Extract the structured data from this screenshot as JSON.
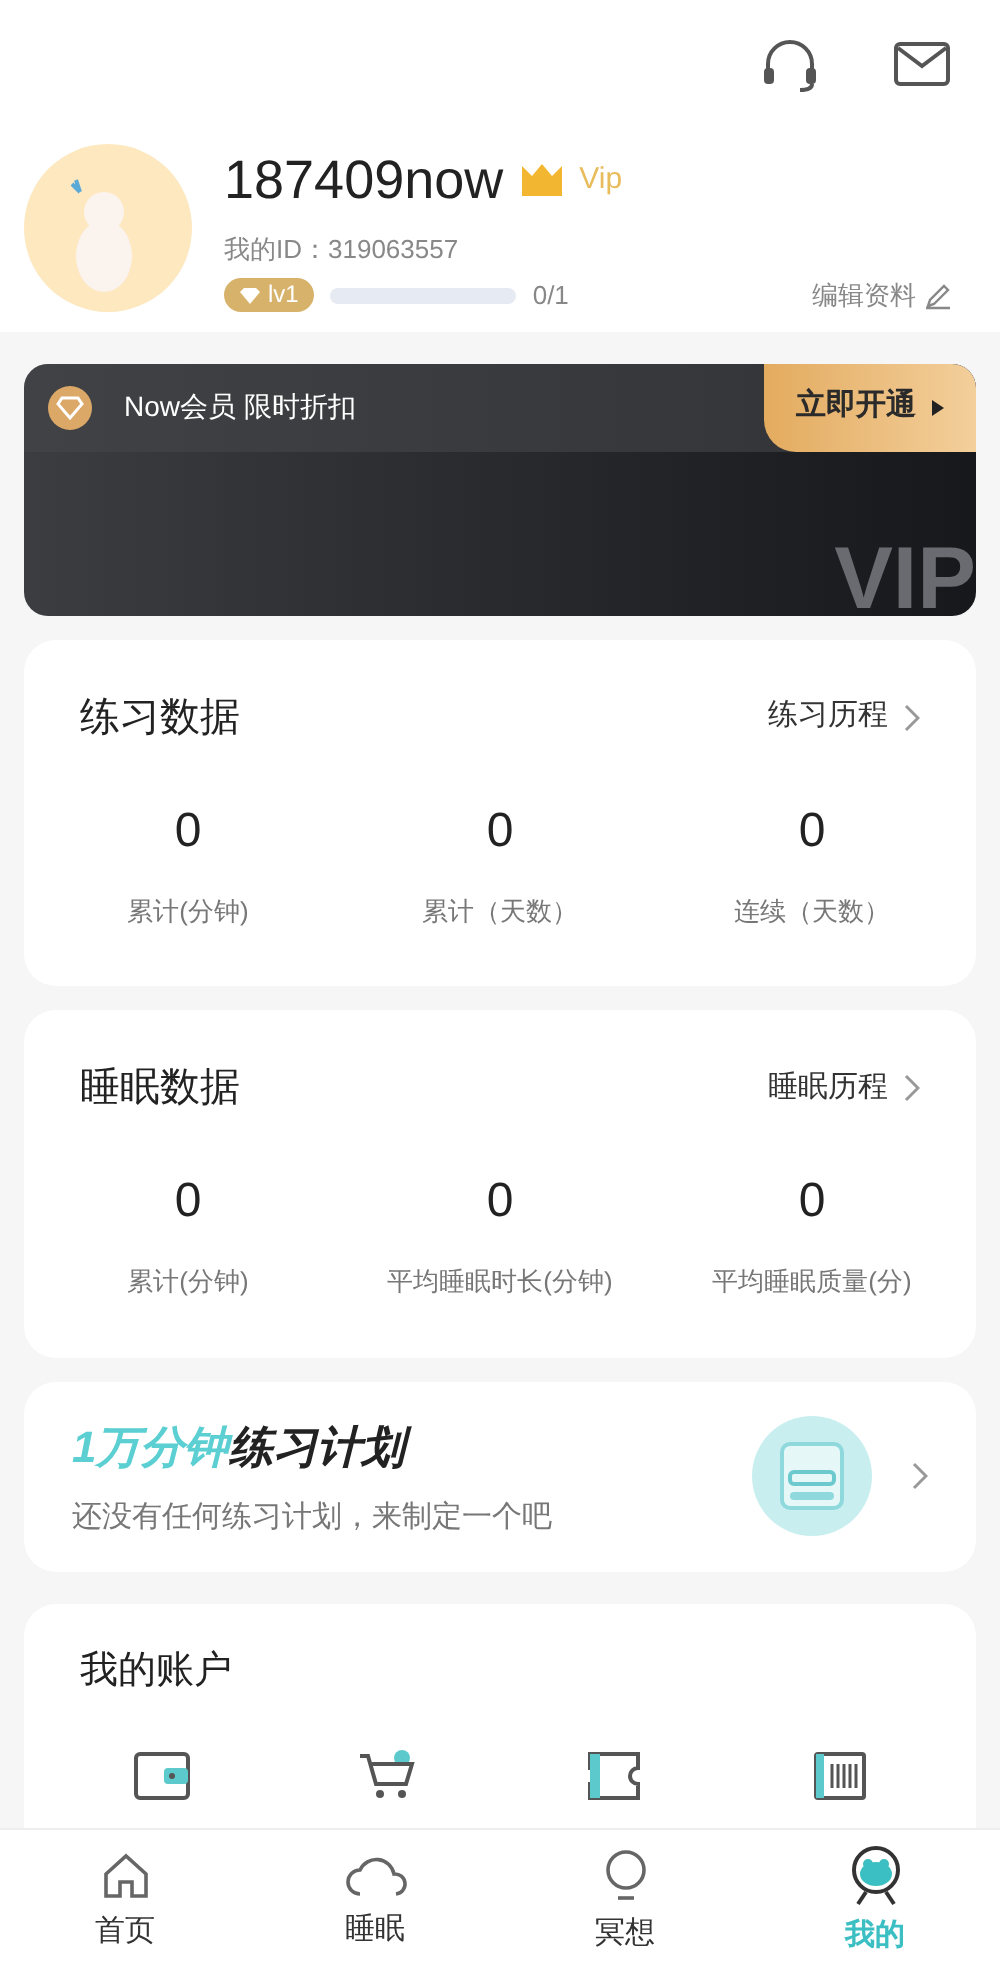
{
  "profile": {
    "username": "187409now",
    "vip_label": "Vip",
    "id_text": "我的ID：319063557",
    "level_badge": "lv1",
    "level": 0,
    "progress_text": "0/1",
    "edit_link": "编辑资料"
  },
  "vip_banner": {
    "title": "Now会员 限时折扣",
    "button": "立即开通",
    "watermark": "VIP"
  },
  "practice": {
    "title": "练习数据",
    "link": "练习历程",
    "stats": [
      {
        "value": "0",
        "label": "累计(分钟)"
      },
      {
        "value": "0",
        "label": "累计（天数）"
      },
      {
        "value": "0",
        "label": "连续（天数）"
      }
    ]
  },
  "sleep": {
    "title": "睡眠数据",
    "link": "睡眠历程",
    "stats": [
      {
        "value": "0",
        "label": "累计(分钟)"
      },
      {
        "value": "0",
        "label": "平均睡眠时长(分钟)"
      },
      {
        "value": "0",
        "label": "平均睡眠质量(分)"
      }
    ]
  },
  "plan": {
    "title_highlight": "1万分钟",
    "title_rest": "练习计划",
    "subtitle": "还没有任何练习计划，来制定一个吧"
  },
  "account": {
    "title": "我的账户",
    "items": [
      {
        "kind": "wallet"
      },
      {
        "kind": "cart"
      },
      {
        "kind": "ticket"
      },
      {
        "kind": "barcode"
      }
    ]
  },
  "nav": [
    {
      "label": "首页",
      "kind": "home",
      "selected": false
    },
    {
      "label": "睡眠",
      "kind": "sleep",
      "selected": false
    },
    {
      "label": "冥想",
      "kind": "meditate",
      "selected": false
    },
    {
      "label": "我的",
      "kind": "me",
      "selected": true
    }
  ]
}
